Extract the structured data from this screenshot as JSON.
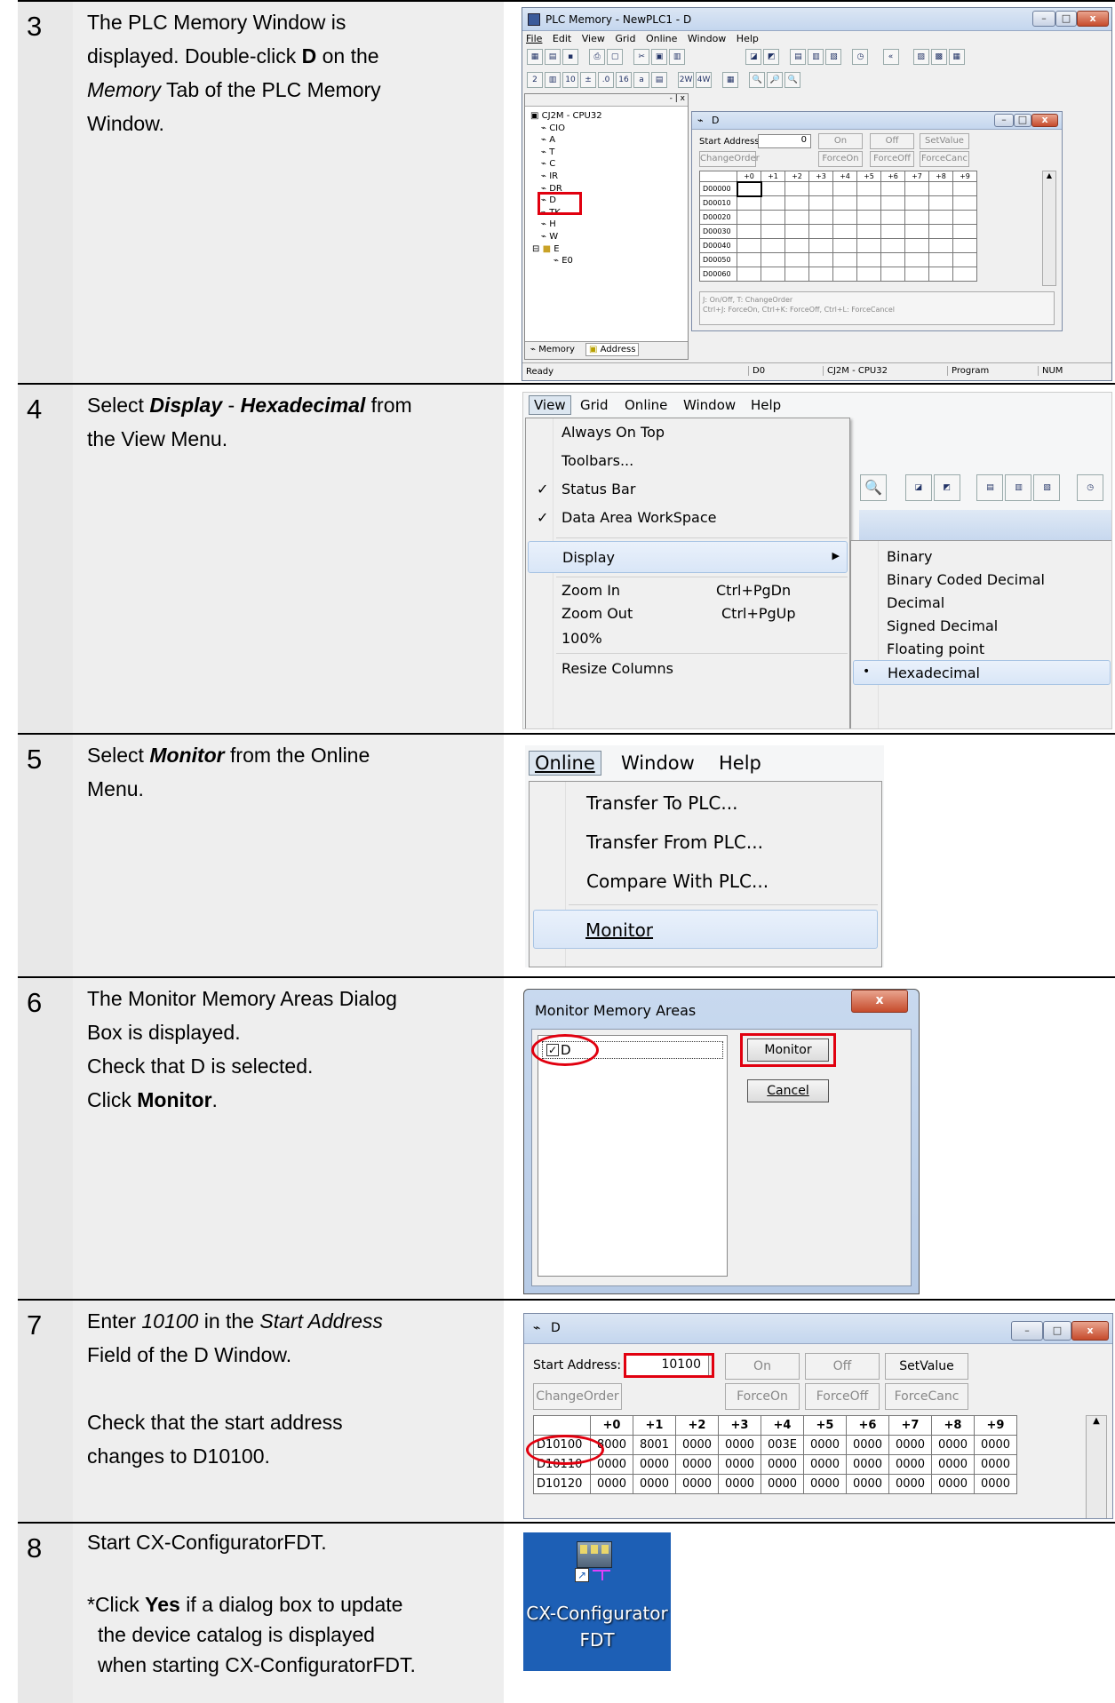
{
  "steps": [
    {
      "num": "3",
      "lines": [
        "The PLC Memory Window is",
        "displayed. Double-click ",
        "D",
        " on the",
        "Memory",
        " Tab of the PLC Memory",
        "Window."
      ]
    },
    {
      "num": "4",
      "lines": [
        "Select ",
        "Display",
        " - ",
        "Hexadecimal",
        " from",
        "the View Menu."
      ]
    },
    {
      "num": "5",
      "lines": [
        "Select ",
        "Monitor",
        " from the Online",
        "Menu."
      ]
    },
    {
      "num": "6",
      "lines": [
        "The Monitor Memory Areas Dialog",
        "Box is displayed.",
        "Check that D is selected.",
        "Click ",
        "Monitor",
        "."
      ]
    },
    {
      "num": "7",
      "lines": [
        "Enter ",
        "10100",
        " in the ",
        "Start Address",
        "Field of the D Window.",
        "Check that the start address",
        "changes to D10100."
      ]
    },
    {
      "num": "8",
      "lines": [
        "Start CX-ConfiguratorFDT.",
        "*Click ",
        "Yes",
        " if a dialog box to update",
        "the device catalog is displayed",
        "when starting CX-ConfiguratorFDT."
      ]
    }
  ],
  "shot3": {
    "title": "PLC Memory - NewPLC1 - D",
    "menu": [
      "File",
      "Edit",
      "View",
      "Grid",
      "Online",
      "Window",
      "Help"
    ],
    "tree_root": "CJ2M - CPU32",
    "tree_items": [
      "CIO",
      "A",
      "T",
      "C",
      "IR",
      "DR",
      "D",
      "TK",
      "H",
      "W",
      "E",
      "E0"
    ],
    "tabs": [
      "Memory",
      "Address"
    ],
    "child_title": "D",
    "start_label": "Start Address:",
    "start_value": "0",
    "buttons_row1": [
      "On",
      "Off",
      "SetValue"
    ],
    "buttons_row2": [
      "ChangeOrder",
      "ForceOn",
      "ForceOff",
      "ForceCanc"
    ],
    "cols": [
      "+0",
      "+1",
      "+2",
      "+3",
      "+4",
      "+5",
      "+6",
      "+7",
      "+8",
      "+9"
    ],
    "rows": [
      "D00000",
      "D00010",
      "D00020",
      "D00030",
      "D00040",
      "D00050",
      "D00060"
    ],
    "hint1": "J: On/Off,   T: ChangeOrder",
    "hint2": "Ctrl+J: ForceOn,   Ctrl+K: ForceOff,   Ctrl+L: ForceCancel",
    "status": [
      "Ready",
      "D0",
      "CJ2M - CPU32",
      "Program",
      "NUM"
    ]
  },
  "shot4": {
    "menubar": [
      "View",
      "Grid",
      "Online",
      "Window",
      "Help"
    ],
    "items": [
      "Always On Top",
      "Toolbars...",
      "Status Bar",
      "Data Area WorkSpace",
      "Display",
      "Zoom In",
      "Zoom Out",
      "100%",
      "Resize Columns"
    ],
    "shortcuts": [
      "Ctrl+PgDn",
      "Ctrl+PgUp"
    ],
    "submenu": [
      "Binary",
      "Binary Coded Decimal",
      "Decimal",
      "Signed Decimal",
      "Floating point",
      "Hexadecimal"
    ]
  },
  "shot5": {
    "menubar": [
      "Online",
      "Window",
      "Help"
    ],
    "items": [
      "Transfer To PLC...",
      "Transfer From PLC...",
      "Compare With PLC...",
      "Monitor"
    ]
  },
  "shot6": {
    "title": "Monitor Memory Areas",
    "item": "D",
    "monitor": "Monitor",
    "cancel": "Cancel"
  },
  "shot7": {
    "title": "D",
    "start_label": "Start Address:",
    "start_value": "10100",
    "buttons_row1": [
      "On",
      "Off",
      "SetValue"
    ],
    "buttons_row2": [
      "ChangeOrder",
      "ForceOn",
      "ForceOff",
      "ForceCanc"
    ],
    "cols": [
      "+0",
      "+1",
      "+2",
      "+3",
      "+4",
      "+5",
      "+6",
      "+7",
      "+8",
      "+9"
    ],
    "rows": [
      {
        "label": "D10100",
        "vals": [
          "8000",
          "8001",
          "0000",
          "0000",
          "003E",
          "0000",
          "0000",
          "0000",
          "0000",
          "0000"
        ]
      },
      {
        "label": "D10110",
        "vals": [
          "0000",
          "0000",
          "0000",
          "0000",
          "0000",
          "0000",
          "0000",
          "0000",
          "0000",
          "0000"
        ]
      },
      {
        "label": "D10120",
        "vals": [
          "0000",
          "0000",
          "0000",
          "0000",
          "0000",
          "0000",
          "0000",
          "0000",
          "0000",
          "0000"
        ]
      }
    ]
  },
  "shot8": {
    "label1": "CX-Configurator",
    "label2": "FDT"
  }
}
